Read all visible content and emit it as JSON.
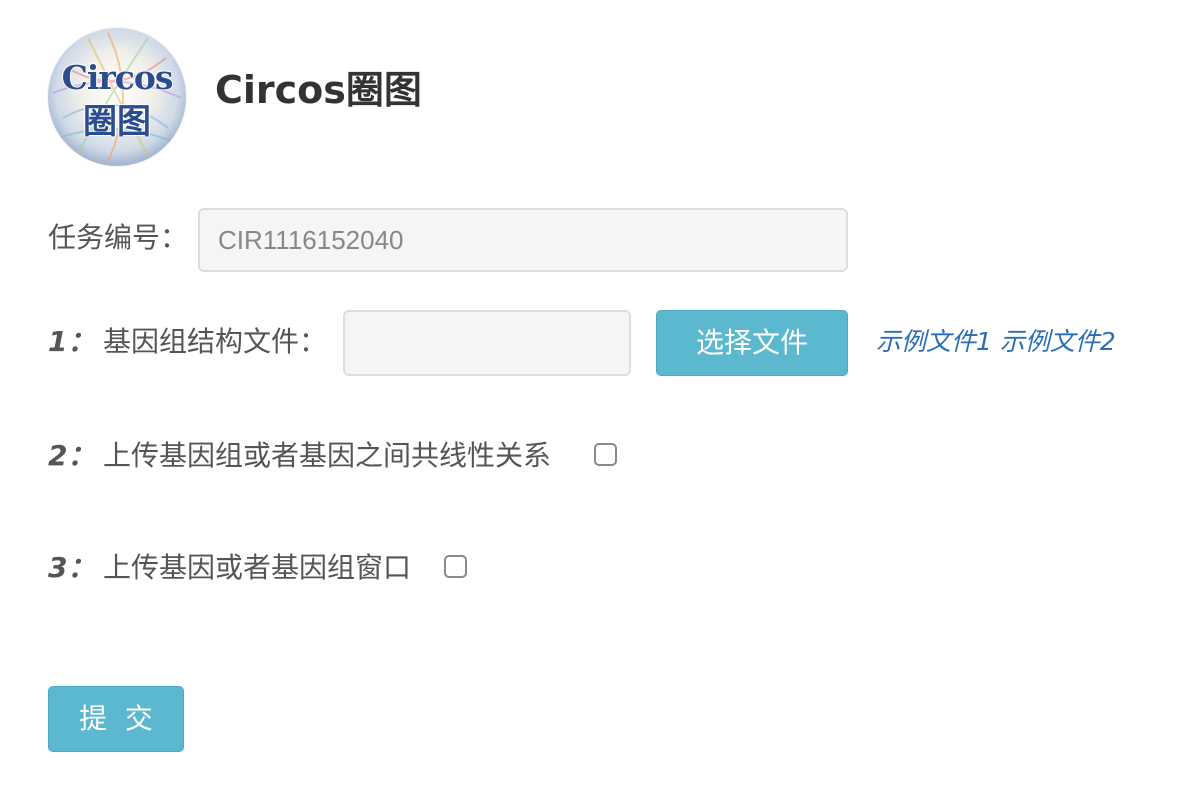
{
  "header": {
    "logo_line1": "Circos",
    "logo_line2": "圈图",
    "title": "Circos圈图"
  },
  "form": {
    "task_id": {
      "label": "任务编号：",
      "value": "CIR1116152040"
    },
    "step1": {
      "number": "1：",
      "label": "基因组结构文件：",
      "value": "",
      "choose_file_label": "选择文件",
      "example1": "示例文件1",
      "example2": "示例文件2"
    },
    "step2": {
      "number": "2：",
      "label": "上传基因组或者基因之间共线性关系",
      "checked": false
    },
    "step3": {
      "number": "3：",
      "label": "上传基因或者基因组窗口",
      "checked": false
    },
    "submit_label": "提  交"
  },
  "colors": {
    "button": "#5bb8cf",
    "link": "#2a6eb8",
    "input_bg": "#f5f5f5"
  }
}
